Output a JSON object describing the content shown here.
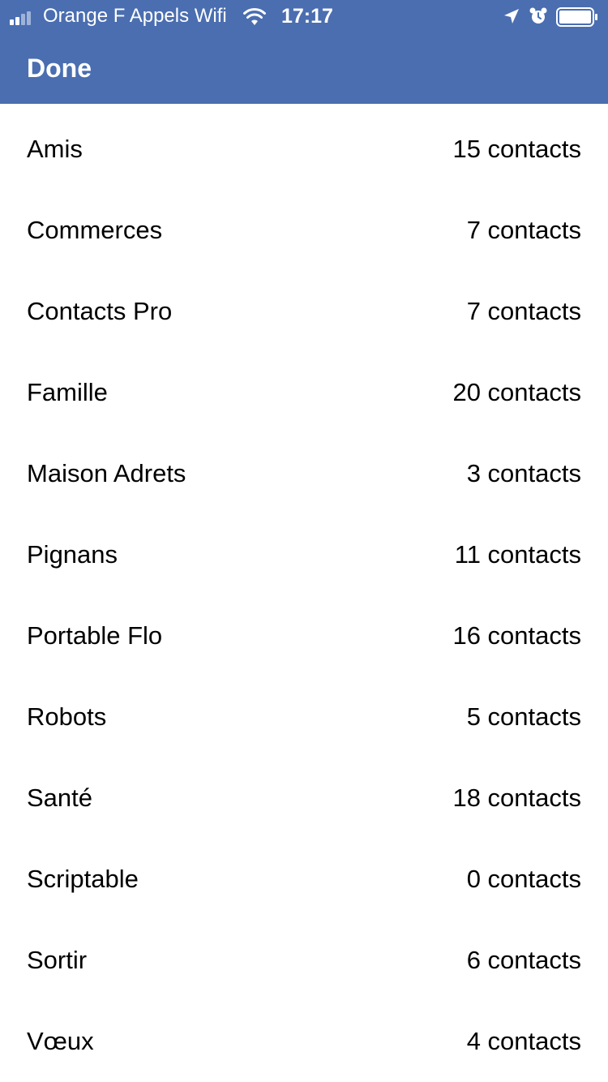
{
  "status_bar": {
    "carrier": "Orange F Appels Wifi",
    "time": "17:17",
    "signal_icon": "cellular-signal-icon",
    "wifi_icon": "wifi-icon",
    "location_icon": "location-arrow-icon",
    "alarm_icon": "alarm-clock-icon",
    "battery_icon": "battery-icon"
  },
  "header": {
    "done_label": "Done",
    "background_color": "#4a6eb0"
  },
  "groups": [
    {
      "name": "Amis",
      "count": "15 contacts"
    },
    {
      "name": "Commerces",
      "count": "7 contacts"
    },
    {
      "name": "Contacts Pro",
      "count": "7 contacts"
    },
    {
      "name": "Famille",
      "count": "20 contacts"
    },
    {
      "name": "Maison Adrets",
      "count": "3 contacts"
    },
    {
      "name": "Pignans",
      "count": "11 contacts"
    },
    {
      "name": "Portable Flo",
      "count": "16 contacts"
    },
    {
      "name": "Robots",
      "count": "5 contacts"
    },
    {
      "name": "Santé",
      "count": "18 contacts"
    },
    {
      "name": "Scriptable",
      "count": "0 contacts"
    },
    {
      "name": "Sortir",
      "count": "6 contacts"
    },
    {
      "name": "Vœux",
      "count": "4 contacts"
    }
  ]
}
